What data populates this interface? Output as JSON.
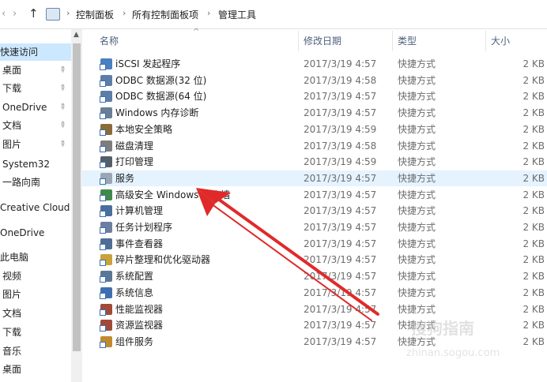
{
  "address": {
    "crumbs": [
      "控制面板",
      "所有控制面板项",
      "管理工具"
    ]
  },
  "sidebar": {
    "items": [
      {
        "label": "快速访问",
        "pinned": false
      },
      {
        "label": "桌面",
        "pinned": true
      },
      {
        "label": "下载",
        "pinned": true
      },
      {
        "label": "OneDrive",
        "pinned": true
      },
      {
        "label": "文档",
        "pinned": true
      },
      {
        "label": "图片",
        "pinned": true
      },
      {
        "label": "System32",
        "pinned": false
      },
      {
        "label": "一路向南",
        "pinned": false
      },
      {
        "label": "Creative Cloud F",
        "pinned": false
      },
      {
        "label": "OneDrive",
        "pinned": false
      },
      {
        "label": "此电脑",
        "pinned": false
      },
      {
        "label": "视频",
        "pinned": false
      },
      {
        "label": "图片",
        "pinned": false
      },
      {
        "label": "文档",
        "pinned": false
      },
      {
        "label": "下载",
        "pinned": false
      },
      {
        "label": "音乐",
        "pinned": false
      },
      {
        "label": "桌面",
        "pinned": false
      }
    ]
  },
  "columns": {
    "name": "名称",
    "date": "修改日期",
    "type": "类型",
    "size": "大小"
  },
  "files": [
    {
      "name": "iSCSI 发起程序",
      "date": "2017/3/19 4:57",
      "type": "快捷方式",
      "size": "2 KB",
      "icon": "iscsi-icon",
      "color": "#4a7fc1"
    },
    {
      "name": "ODBC 数据源(32 位)",
      "date": "2017/3/19 4:58",
      "type": "快捷方式",
      "size": "2 KB",
      "icon": "odbc-icon",
      "color": "#5b7ea8"
    },
    {
      "name": "ODBC 数据源(64 位)",
      "date": "2017/3/19 4:57",
      "type": "快捷方式",
      "size": "2 KB",
      "icon": "odbc-icon",
      "color": "#5b7ea8"
    },
    {
      "name": "Windows 内存诊断",
      "date": "2017/3/19 4:57",
      "type": "快捷方式",
      "size": "2 KB",
      "icon": "memory-diagnostic-icon",
      "color": "#6a7f95"
    },
    {
      "name": "本地安全策略",
      "date": "2017/3/19 4:59",
      "type": "快捷方式",
      "size": "2 KB",
      "icon": "security-policy-icon",
      "color": "#8a6b3a"
    },
    {
      "name": "磁盘清理",
      "date": "2017/3/19 4:58",
      "type": "快捷方式",
      "size": "2 KB",
      "icon": "disk-cleanup-icon",
      "color": "#7d7d7d"
    },
    {
      "name": "打印管理",
      "date": "2017/3/19 4:59",
      "type": "快捷方式",
      "size": "2 KB",
      "icon": "print-management-icon",
      "color": "#555f6a"
    },
    {
      "name": "服务",
      "date": "2017/3/19 4:57",
      "type": "快捷方式",
      "size": "2 KB",
      "icon": "services-icon",
      "color": "#9aa6b3"
    },
    {
      "name": "高级安全 Windows 防火墙",
      "date": "2017/3/19 4:57",
      "type": "快捷方式",
      "size": "2 KB",
      "icon": "firewall-icon",
      "color": "#3f8a4a"
    },
    {
      "name": "计算机管理",
      "date": "2017/3/19 4:57",
      "type": "快捷方式",
      "size": "2 KB",
      "icon": "computer-management-icon",
      "color": "#4b6f9c"
    },
    {
      "name": "任务计划程序",
      "date": "2017/3/19 4:57",
      "type": "快捷方式",
      "size": "2 KB",
      "icon": "task-scheduler-icon",
      "color": "#6d7fa0"
    },
    {
      "name": "事件查看器",
      "date": "2017/3/19 4:57",
      "type": "快捷方式",
      "size": "2 KB",
      "icon": "event-viewer-icon",
      "color": "#4f6e96"
    },
    {
      "name": "碎片整理和优化驱动器",
      "date": "2017/3/19 4:57",
      "type": "快捷方式",
      "size": "2 KB",
      "icon": "defrag-icon",
      "color": "#c9a33a"
    },
    {
      "name": "系统配置",
      "date": "2017/3/19 4:57",
      "type": "快捷方式",
      "size": "2 KB",
      "icon": "system-config-icon",
      "color": "#5a7896"
    },
    {
      "name": "系统信息",
      "date": "2017/3/19 4:57",
      "type": "快捷方式",
      "size": "2 KB",
      "icon": "system-info-icon",
      "color": "#3f6fb0"
    },
    {
      "name": "性能监视器",
      "date": "2017/3/19 4:57",
      "type": "快捷方式",
      "size": "2 KB",
      "icon": "performance-monitor-icon",
      "color": "#a04a3a"
    },
    {
      "name": "资源监视器",
      "date": "2017/3/19 4:57",
      "type": "快捷方式",
      "size": "2 KB",
      "icon": "resource-monitor-icon",
      "color": "#a04a3a"
    },
    {
      "name": "组件服务",
      "date": "2017/3/19 4:57",
      "type": "快捷方式",
      "size": "2 KB",
      "icon": "component-services-icon",
      "color": "#c28a2e"
    }
  ],
  "highlighted_row": 7,
  "watermark": {
    "logo_text": "搜狗指南",
    "url_text": "zhinan.sogou.com"
  },
  "colors": {
    "selected_nav": "#cce8ff",
    "hover_row": "#e5f3ff",
    "annotation_arrow": "#e02a2a",
    "header_text": "#4c607a"
  }
}
